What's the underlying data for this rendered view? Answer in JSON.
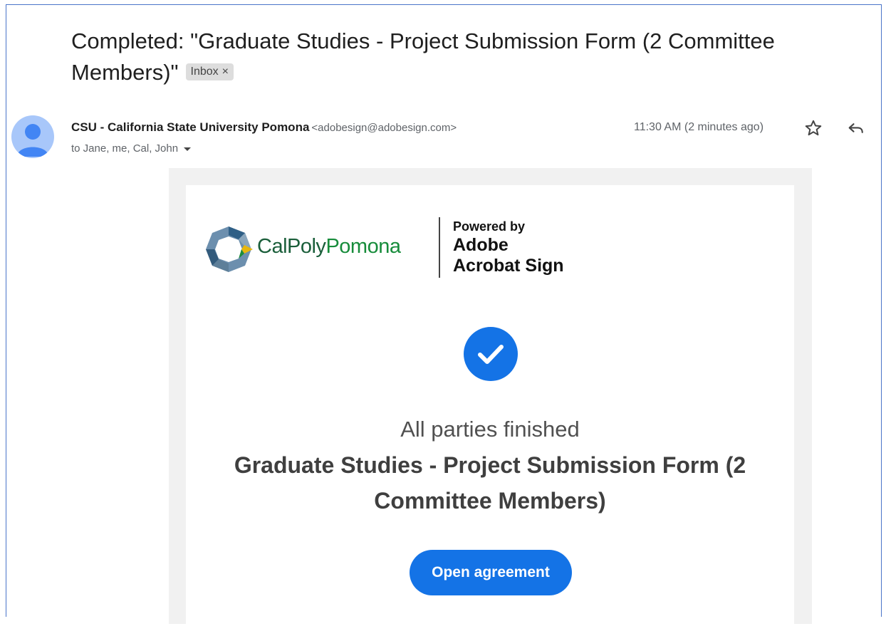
{
  "email": {
    "subject": "Completed: \"Graduate Studies - Project Submission Form (2 Committee Members)\"",
    "label_chip": "Inbox",
    "label_remove": "×",
    "sender_name": "CSU - California State University Pomona",
    "sender_email": "<adobesign@adobesign.com>",
    "recipients": "to Jane, me, Cal, John",
    "time": "11:30 AM (2 minutes ago)"
  },
  "icons": {
    "avatar": "person-icon",
    "star": "star-icon",
    "reply": "reply-icon",
    "recipients_toggle": "caret-down-icon",
    "status": "checkmark-icon"
  },
  "body": {
    "logo_cal_poly": "CalPoly",
    "logo_pomona": "Pomona",
    "powered_by": "Powered by",
    "powered_brand_1": "Adobe",
    "powered_brand_2": "Acrobat Sign",
    "status": "All parties finished",
    "document_title": "Graduate Studies - Project Submission Form (2 Committee Members)",
    "button_label": "Open agreement"
  },
  "colors": {
    "accent_blue": "#1473e6",
    "frame_border": "#4a74c9",
    "avatar_bg": "#a8c7fa",
    "logo_green": "#178c3b"
  }
}
